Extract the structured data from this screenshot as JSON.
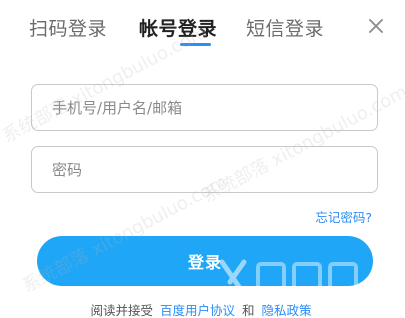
{
  "tabs": [
    {
      "label": "扫码登录"
    },
    {
      "label": "帐号登录"
    },
    {
      "label": "短信登录"
    }
  ],
  "active_tab": 1,
  "username": {
    "placeholder": "手机号/用户名/邮箱",
    "value": ""
  },
  "password": {
    "placeholder": "密码",
    "value": ""
  },
  "forgot_label": "忘记密码?",
  "login_label": "登录",
  "agreement": {
    "prefix": "阅读并接受",
    "terms_link": "百度用户协议",
    "and": "和",
    "privacy_link": "隐私政策"
  },
  "watermark_text": "系统部落 xitongbuluo.com",
  "icons": {
    "close": "close-icon"
  },
  "colors": {
    "accent": "#2b8ef5",
    "button": "#1fa6f7"
  }
}
